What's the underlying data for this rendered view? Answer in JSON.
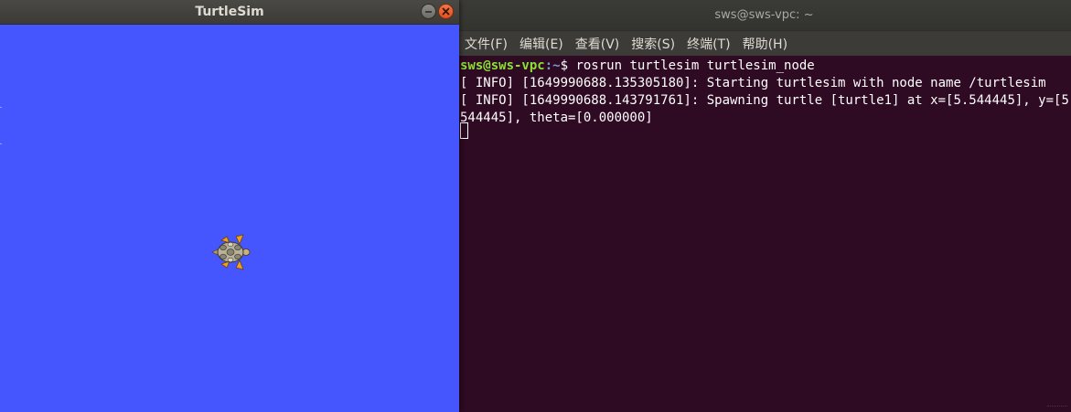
{
  "terminal": {
    "title": "sws@sws-vpc: ~",
    "menu": [
      "文件(F)",
      "编辑(E)",
      "查看(V)",
      "搜索(S)",
      "终端(T)",
      "帮助(H)"
    ],
    "prompt_user": "sws@sws-vpc",
    "prompt_path": ":~",
    "prompt_symbol": "$ ",
    "command": "rosrun turtlesim turtlesim_node",
    "output_lines": [
      "[ INFO] [1649990688.135305180]: Starting turtlesim with node name /turtlesim",
      "[ INFO] [1649990688.143791761]: Spawning turtle [turtle1] at x=[5.544445], y=[5.",
      "544445], theta=[0.000000]"
    ]
  },
  "turtlesim": {
    "title": "TurtleSim",
    "background_color": "#4556ff",
    "turtle_name": "turtle1"
  },
  "colors": {
    "terminal_bg": "#300a24",
    "prompt_user": "#8ae234",
    "prompt_path": "#729fcf"
  },
  "icons": {
    "minimize": "minimize-icon",
    "close": "close-icon",
    "turtle": "turtle-icon"
  }
}
